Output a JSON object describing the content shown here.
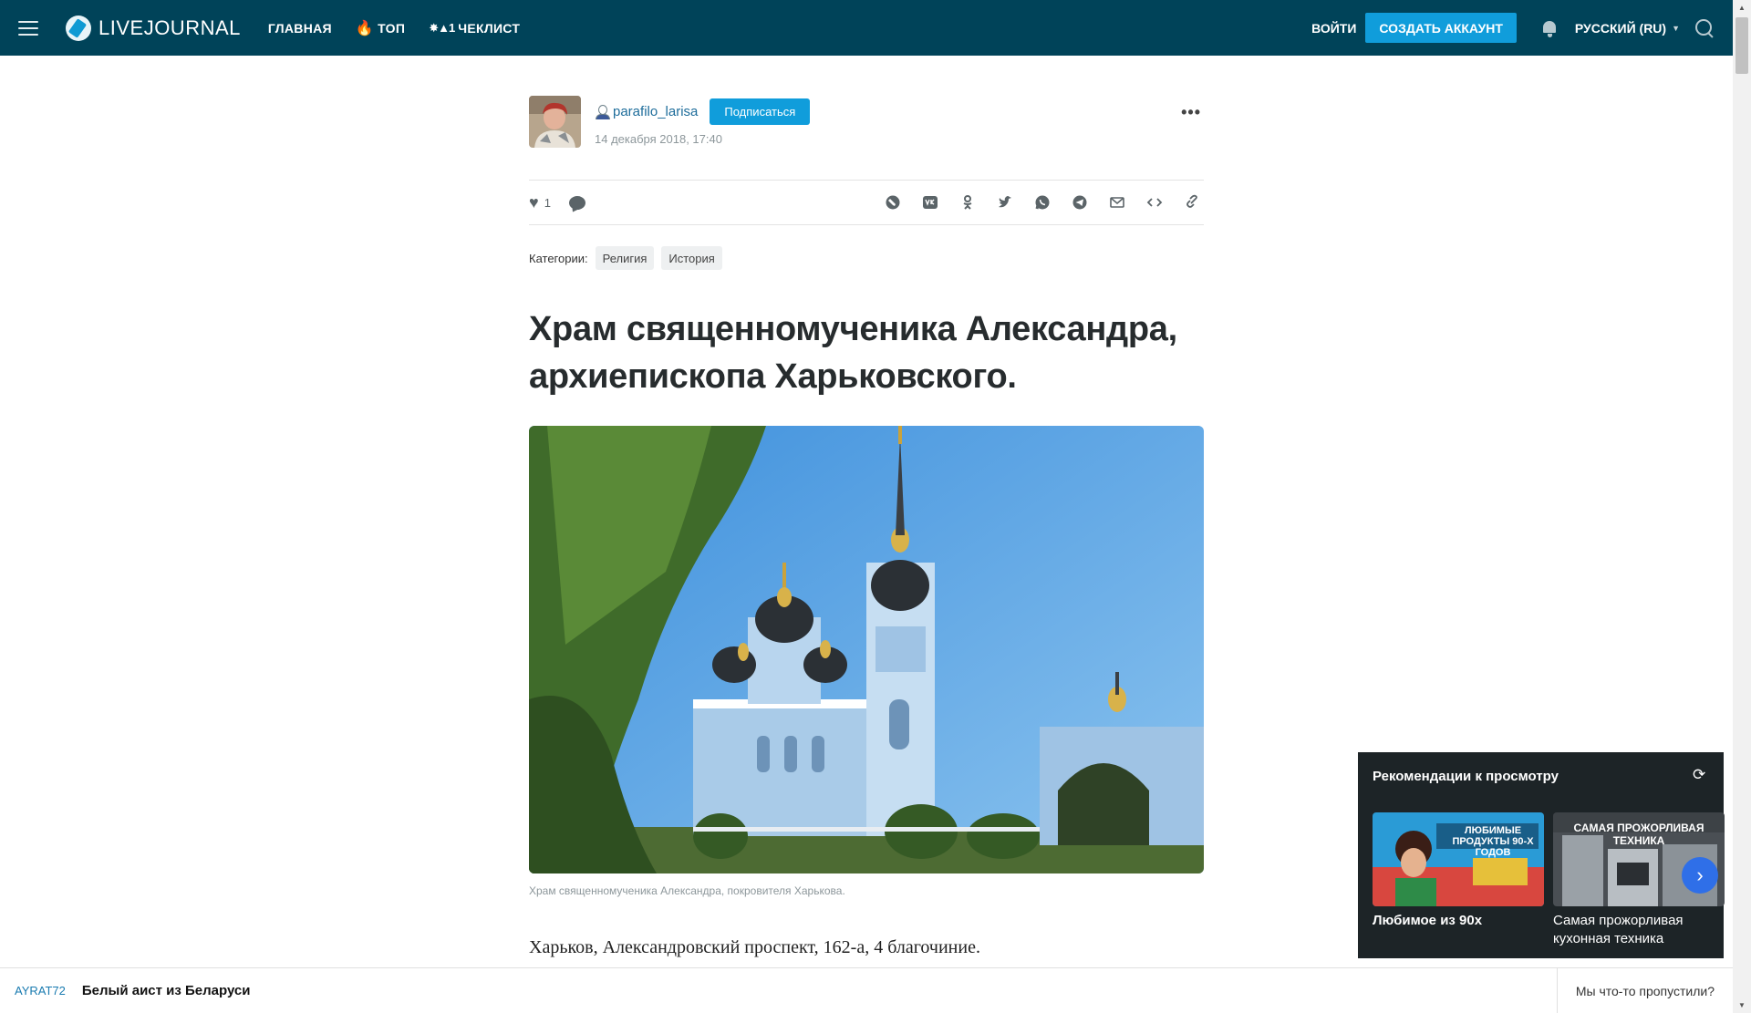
{
  "header": {
    "logo_text": "LIVEJOURNAL",
    "nav": [
      {
        "label": "ГЛАВНАЯ"
      },
      {
        "label": "ТОП"
      },
      {
        "label": "ЧЕКЛИСТ"
      }
    ],
    "login_label": "ВОЙТИ",
    "create_account_label": "СОЗДАТЬ АККАУНТ",
    "language_label": "РУССКИЙ (RU)"
  },
  "post": {
    "author": "parafilo_larisa",
    "subscribe_label": "Подписаться",
    "date": "14 декабря 2018, 17:40",
    "likes": "1",
    "categories_label": "Категории:",
    "categories": [
      "Религия",
      "История"
    ],
    "title": "Храм священномученика Александра, архиепископа Харьковского.",
    "photo_caption": "Храм священномученика Александра, покровителя Харькова.",
    "first_paragraph": "Харьков, Александровский проспект, 162-а, 4 благочиние."
  },
  "recommendations": {
    "title": "Рекомендации к просмотру",
    "cards": [
      {
        "title": "Любимое из 90х",
        "thumb_text": "ЛЮБИМЫЕ ПРОДУКТЫ 90-Х ГОДОВ"
      },
      {
        "title": "Самая прожорливая кухонная техника",
        "thumb_text": "САМАЯ ПРОЖОРЛИВАЯ ТЕХНИКА"
      }
    ]
  },
  "bottom_bar": {
    "user": "AYRAT72",
    "title": "Белый аист из Беларуси",
    "right_label": "Мы что-то пропустили?"
  },
  "colors": {
    "header_bg": "#004359",
    "accent": "#109ddb",
    "link": "#1e6d9b"
  }
}
